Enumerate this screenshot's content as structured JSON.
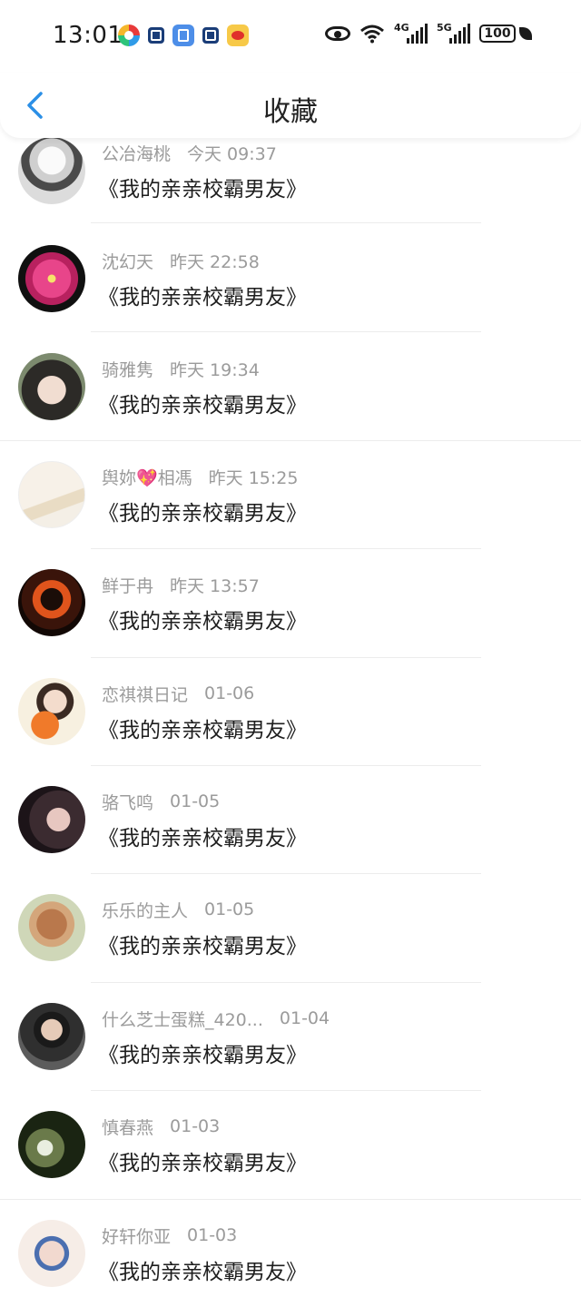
{
  "status_bar": {
    "time": "13:01",
    "notification_icons": [
      "gallery-icon",
      "dk-app-icon",
      "lock-app-icon",
      "dk-app-icon",
      "weibo-icon"
    ],
    "network_4g": "4G",
    "network_5g": "5G",
    "battery": "100"
  },
  "header": {
    "title": "收藏",
    "back_icon": "chevron-left-icon",
    "accent_color": "#2b8fe6"
  },
  "items": [
    {
      "name": "公冶海桃",
      "time": "今天 09:37",
      "title": "《我的亲亲校霸男友》"
    },
    {
      "name": "沈幻天",
      "time": "昨天 22:58",
      "title": "《我的亲亲校霸男友》"
    },
    {
      "name": "骑雅隽",
      "time": "昨天 19:34",
      "title": "《我的亲亲校霸男友》"
    },
    {
      "name": "舆妳💖相馮",
      "time": "昨天 15:25",
      "title": "《我的亲亲校霸男友》"
    },
    {
      "name": "鲜于冉",
      "time": "昨天 13:57",
      "title": "《我的亲亲校霸男友》"
    },
    {
      "name": "恋祺祺日记",
      "time": "01-06",
      "title": "《我的亲亲校霸男友》"
    },
    {
      "name": "骆飞鸣",
      "time": "01-05",
      "title": "《我的亲亲校霸男友》"
    },
    {
      "name": "乐乐的主人",
      "time": "01-05",
      "title": "《我的亲亲校霸男友》"
    },
    {
      "name": "什么芝士蛋糕_420...",
      "time": "01-04",
      "title": "《我的亲亲校霸男友》"
    },
    {
      "name": "慎春燕",
      "time": "01-03",
      "title": "《我的亲亲校霸男友》"
    },
    {
      "name": "好轩你亚",
      "time": "01-03",
      "title": "《我的亲亲校霸男友》"
    }
  ]
}
